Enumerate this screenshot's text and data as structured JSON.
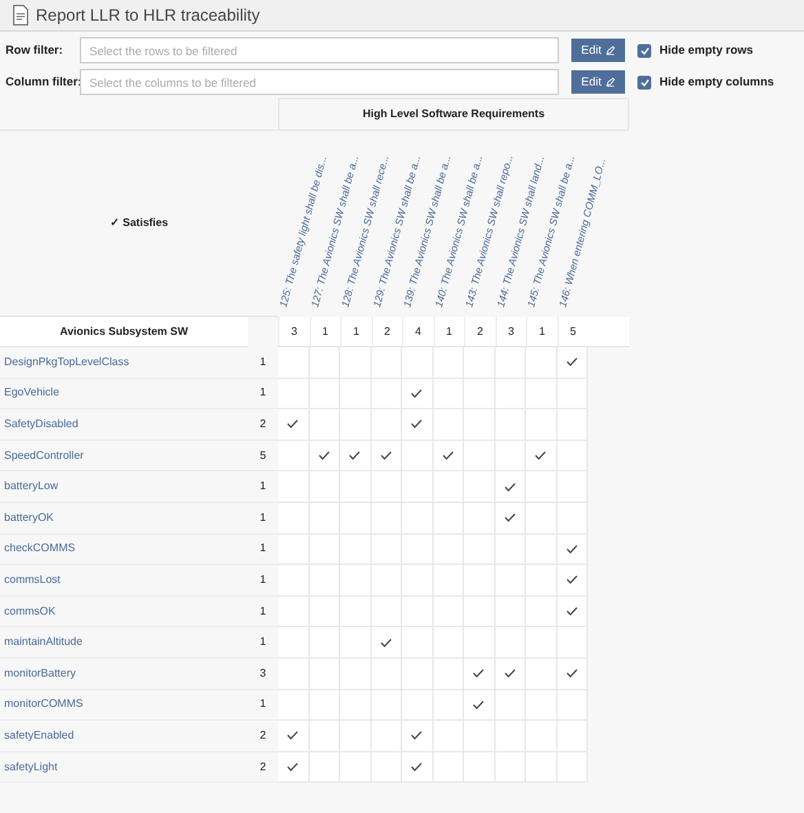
{
  "window": {
    "title": "Report LLR to HLR traceability"
  },
  "filters": [
    {
      "label": "Row filter:",
      "placeholder": "Select the rows to be filtered",
      "button": "Edit",
      "option": "Hide empty rows",
      "checked": true
    },
    {
      "label": "Column filter:",
      "placeholder": "Select the columns to be filtered",
      "button": "Edit",
      "option": "Hide empty columns",
      "checked": true
    }
  ],
  "matrix": {
    "column_group": "High Level Software Requirements",
    "relation": "✓ Satisfies",
    "row_group": "Avionics Subsystem SW",
    "columns": [
      {
        "label": "125: The safety light shall be dis...",
        "count": "3"
      },
      {
        "label": "127: The Avionics SW shall be a...",
        "count": "1"
      },
      {
        "label": "128: The Avionics SW shall rece...",
        "count": "1"
      },
      {
        "label": "129: The Avionics SW shall be a...",
        "count": "2"
      },
      {
        "label": "139: The Avionics SW shall be a...",
        "count": "4"
      },
      {
        "label": "140: The Avionics SW shall be a...",
        "count": "1"
      },
      {
        "label": "143: The Avionics SW shall repo...",
        "count": "2"
      },
      {
        "label": "144: The Avionics SW shall land...",
        "count": "3"
      },
      {
        "label": "145: The Avionics SW shall be a...",
        "count": "1"
      },
      {
        "label": "146: When entering COMM_LO...",
        "count": "5"
      }
    ],
    "rows": [
      {
        "name": "DesignPkgTopLevelClass",
        "count": "1",
        "cells": [
          false,
          false,
          false,
          false,
          false,
          false,
          false,
          false,
          false,
          true
        ]
      },
      {
        "name": "EgoVehicle",
        "count": "1",
        "cells": [
          false,
          false,
          false,
          false,
          true,
          false,
          false,
          false,
          false,
          false
        ]
      },
      {
        "name": "SafetyDisabled",
        "count": "2",
        "cells": [
          true,
          false,
          false,
          false,
          true,
          false,
          false,
          false,
          false,
          false
        ]
      },
      {
        "name": "SpeedController",
        "count": "5",
        "cells": [
          false,
          true,
          true,
          true,
          false,
          true,
          false,
          false,
          true,
          false
        ]
      },
      {
        "name": "batteryLow",
        "count": "1",
        "cells": [
          false,
          false,
          false,
          false,
          false,
          false,
          false,
          true,
          false,
          false
        ]
      },
      {
        "name": "batteryOK",
        "count": "1",
        "cells": [
          false,
          false,
          false,
          false,
          false,
          false,
          false,
          true,
          false,
          false
        ]
      },
      {
        "name": "checkCOMMS",
        "count": "1",
        "cells": [
          false,
          false,
          false,
          false,
          false,
          false,
          false,
          false,
          false,
          true
        ]
      },
      {
        "name": "commsLost",
        "count": "1",
        "cells": [
          false,
          false,
          false,
          false,
          false,
          false,
          false,
          false,
          false,
          true
        ]
      },
      {
        "name": "commsOK",
        "count": "1",
        "cells": [
          false,
          false,
          false,
          false,
          false,
          false,
          false,
          false,
          false,
          true
        ]
      },
      {
        "name": "maintainAltitude",
        "count": "1",
        "cells": [
          false,
          false,
          false,
          true,
          false,
          false,
          false,
          false,
          false,
          false
        ]
      },
      {
        "name": "monitorBattery",
        "count": "3",
        "cells": [
          false,
          false,
          false,
          false,
          false,
          false,
          true,
          true,
          false,
          true
        ]
      },
      {
        "name": "monitorCOMMS",
        "count": "1",
        "cells": [
          false,
          false,
          false,
          false,
          false,
          false,
          true,
          false,
          false,
          false
        ]
      },
      {
        "name": "safetyEnabled",
        "count": "2",
        "cells": [
          true,
          false,
          false,
          false,
          true,
          false,
          false,
          false,
          false,
          false
        ]
      },
      {
        "name": "safetyLight",
        "count": "2",
        "cells": [
          true,
          false,
          false,
          false,
          true,
          false,
          false,
          false,
          false,
          false
        ]
      }
    ]
  }
}
